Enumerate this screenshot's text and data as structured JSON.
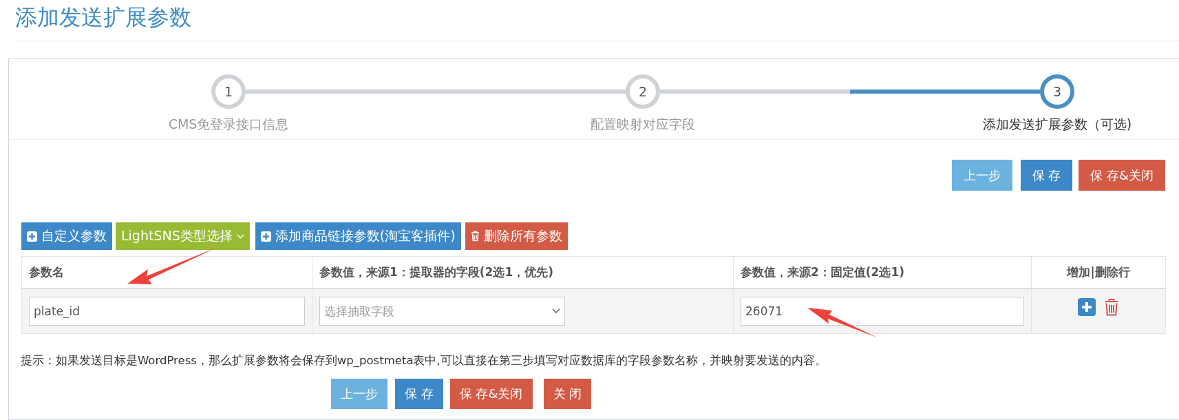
{
  "page_title": "添加发送扩展参数",
  "steps": [
    {
      "number": "1",
      "label": "CMS免登录接口信息",
      "selected": false
    },
    {
      "number": "2",
      "label": "配置映射对应字段",
      "selected": false
    },
    {
      "number": "3",
      "label": "添加发送扩展参数（可选)",
      "selected": true
    }
  ],
  "top_buttons": [
    {
      "label": "上一步",
      "kind": "light"
    },
    {
      "label": "保 存",
      "kind": "primary"
    },
    {
      "label": "保 存&关闭",
      "kind": "danger"
    }
  ],
  "toolbar": [
    {
      "label": "自定义参数",
      "kind": "add"
    },
    {
      "label": "LightSNS类型选择",
      "kind": "dropdown"
    },
    {
      "label": "添加商品链接参数(淘宝客插件)",
      "kind": "add"
    },
    {
      "label": "删除所有参数",
      "kind": "delete"
    }
  ],
  "table": {
    "columns": [
      "参数名",
      "参数值，来源1：提取器的字段(2选1，优先)",
      "参数值，来源2：固定值(2选1)",
      "增加|删除行"
    ],
    "rows": [
      {
        "name": "plate_id",
        "source_field_placeholder": "选择抽取字段",
        "fixed_value": "26071"
      }
    ]
  },
  "hint": "提示：如果发送目标是WordPress，那么扩展参数将会保存到wp_postmeta表中,可以直接在第三步填写对应数据库的字段参数名称，并映射要发送的内容。",
  "bottom_buttons": [
    {
      "label": "上一步",
      "kind": "light"
    },
    {
      "label": "保 存",
      "kind": "primary"
    },
    {
      "label": "保 存&关闭",
      "kind": "danger"
    },
    {
      "label": "关 闭",
      "kind": "danger"
    }
  ]
}
